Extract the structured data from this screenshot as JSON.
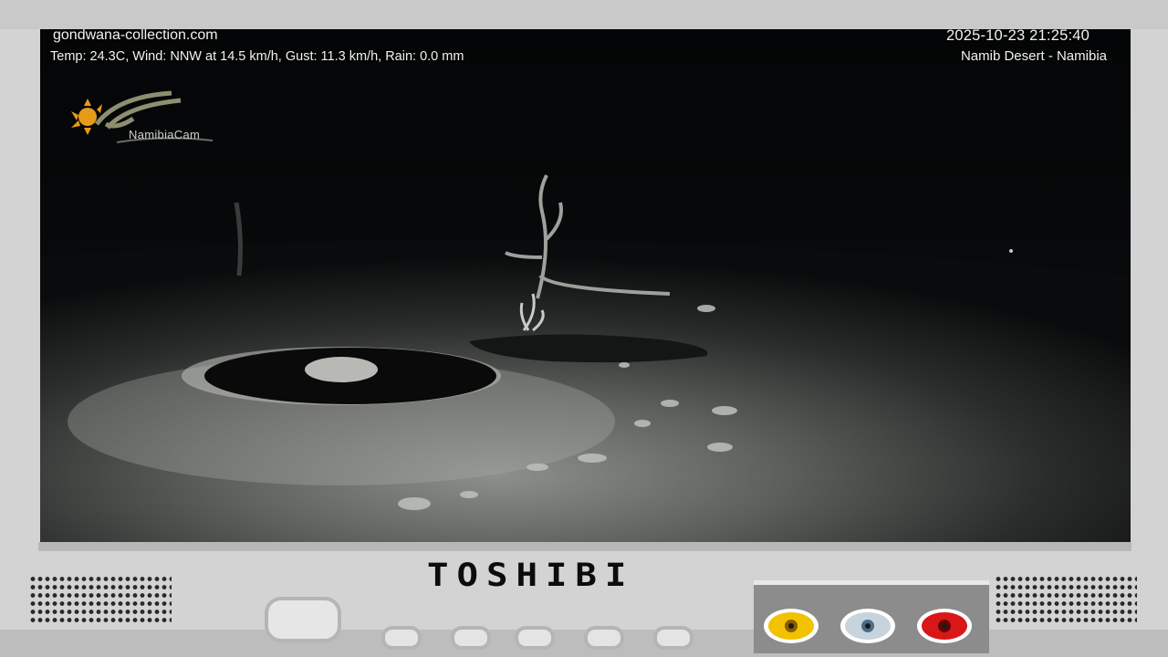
{
  "overlay": {
    "site": "gondwana-collection.com",
    "weather": "Temp: 24.3C, Wind: NNW at 14.5 km/h, Gust: 11.3 km/h, Rain: 0.0 mm",
    "datetime": "2025-10-23 21:25:40",
    "location": "Namib Desert - Namibia"
  },
  "logo": {
    "text": "NamibiaCam"
  },
  "tv": {
    "brand": "TOSHIBI",
    "av_jacks": [
      {
        "name": "yellow-video-jack",
        "color": "#f2c200"
      },
      {
        "name": "white-audio-jack",
        "color": "#c8d4dc"
      },
      {
        "name": "red-audio-jack",
        "color": "#d81818"
      }
    ]
  }
}
